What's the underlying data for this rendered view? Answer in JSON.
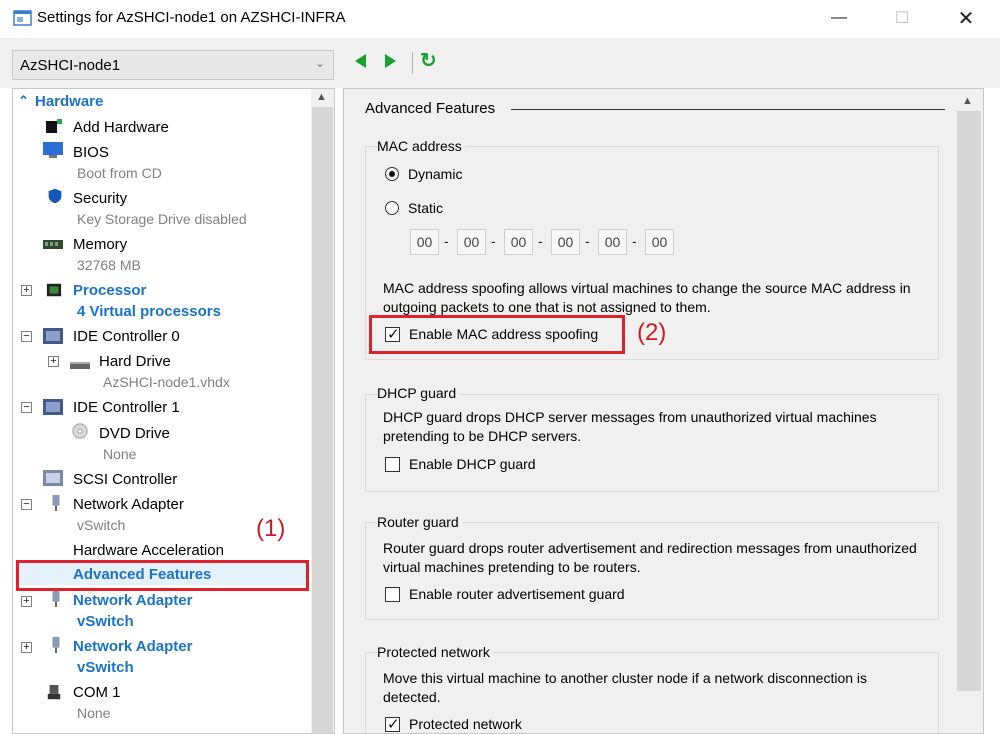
{
  "window": {
    "title": "Settings for AzSHCI-node1 on AZSHCI-INFRA",
    "min_glyph": "—",
    "max_glyph": "☐",
    "close_glyph": "✕"
  },
  "vm_selector": {
    "value": "AzSHCI-node1",
    "arrow": "⌄"
  },
  "nav": {
    "refresh_glyph": "↻"
  },
  "tree": {
    "hardware": {
      "label": "Hardware",
      "glyph": "⌃"
    },
    "add_hardware": "Add Hardware",
    "bios": {
      "label": "BIOS",
      "sub": "Boot from CD"
    },
    "security": {
      "label": "Security",
      "sub": "Key Storage Drive disabled"
    },
    "memory": {
      "label": "Memory",
      "sub": "32768 MB"
    },
    "processor": {
      "label": "Processor",
      "sub": "4 Virtual processors"
    },
    "ide0": {
      "label": "IDE Controller 0"
    },
    "hard_drive": {
      "label": "Hard Drive",
      "sub": "AzSHCI-node1.vhdx"
    },
    "ide1": {
      "label": "IDE Controller 1"
    },
    "dvd": {
      "label": "DVD Drive",
      "sub": "None"
    },
    "scsi": {
      "label": "SCSI Controller"
    },
    "net1": {
      "label": "Network Adapter",
      "sub": "vSwitch"
    },
    "hw_accel": "Hardware Acceleration",
    "adv_features": "Advanced Features",
    "net2": {
      "label": "Network Adapter",
      "sub": "vSwitch"
    },
    "net3": {
      "label": "Network Adapter",
      "sub": "vSwitch"
    },
    "com1": {
      "label": "COM 1",
      "sub": "None"
    },
    "plus": "+",
    "minus": "−"
  },
  "panel": {
    "title": "Advanced Features",
    "mac": {
      "title": "MAC address",
      "dynamic": "Dynamic",
      "static": "Static",
      "octets": [
        "00",
        "00",
        "00",
        "00",
        "00",
        "00"
      ],
      "dash": "-",
      "spoof_desc": "MAC address spoofing allows virtual machines to change the source MAC address in outgoing packets to one that is not assigned to them.",
      "spoof_label": "Enable MAC address spoofing",
      "spoof_checked": true
    },
    "dhcp": {
      "title": "DHCP guard",
      "desc": "DHCP guard drops DHCP server messages from unauthorized virtual machines pretending to be DHCP servers.",
      "label": "Enable DHCP guard",
      "checked": false
    },
    "router": {
      "title": "Router guard",
      "desc": "Router guard drops router advertisement and redirection messages from unauthorized virtual machines pretending to be routers.",
      "label": "Enable router advertisement guard",
      "checked": false
    },
    "protected": {
      "title": "Protected network",
      "desc": "Move this virtual machine to another cluster node if a network disconnection is detected.",
      "label": "Protected network",
      "checked": true
    }
  },
  "annotations": {
    "one": "(1)",
    "two": "(2)",
    "check_glyph": "✓",
    "highlight_color": "#e0202a"
  }
}
